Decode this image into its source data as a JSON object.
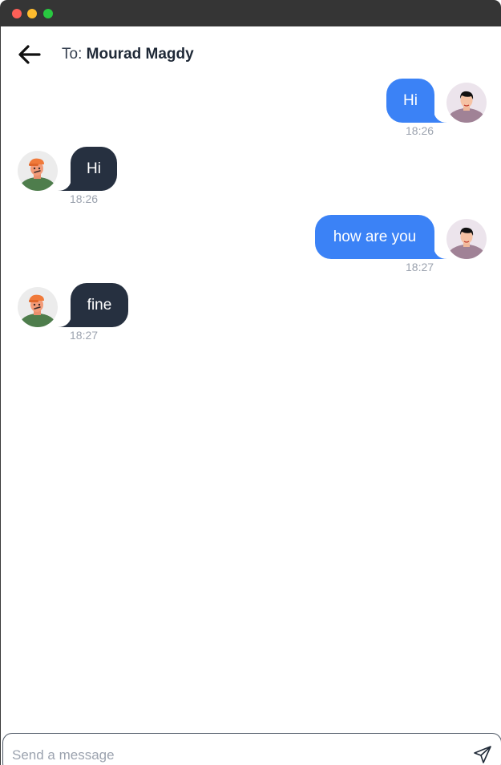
{
  "header": {
    "to_prefix": "To:",
    "recipient_name": "Mourad Magdy"
  },
  "messages": [
    {
      "direction": "outgoing",
      "text": "Hi",
      "time": "18:26"
    },
    {
      "direction": "incoming",
      "text": "Hi",
      "time": "18:26"
    },
    {
      "direction": "outgoing",
      "text": "how are you",
      "time": "18:27"
    },
    {
      "direction": "incoming",
      "text": "fine",
      "time": "18:27"
    }
  ],
  "composer": {
    "placeholder": "Send a message",
    "value": ""
  },
  "colors": {
    "outgoing_bubble": "#3b82f6",
    "incoming_bubble": "#263040",
    "timestamp": "#9ca3af",
    "titlebar": "#353535"
  },
  "icons": {
    "back": "arrow-left-icon",
    "send": "paper-plane-icon"
  }
}
